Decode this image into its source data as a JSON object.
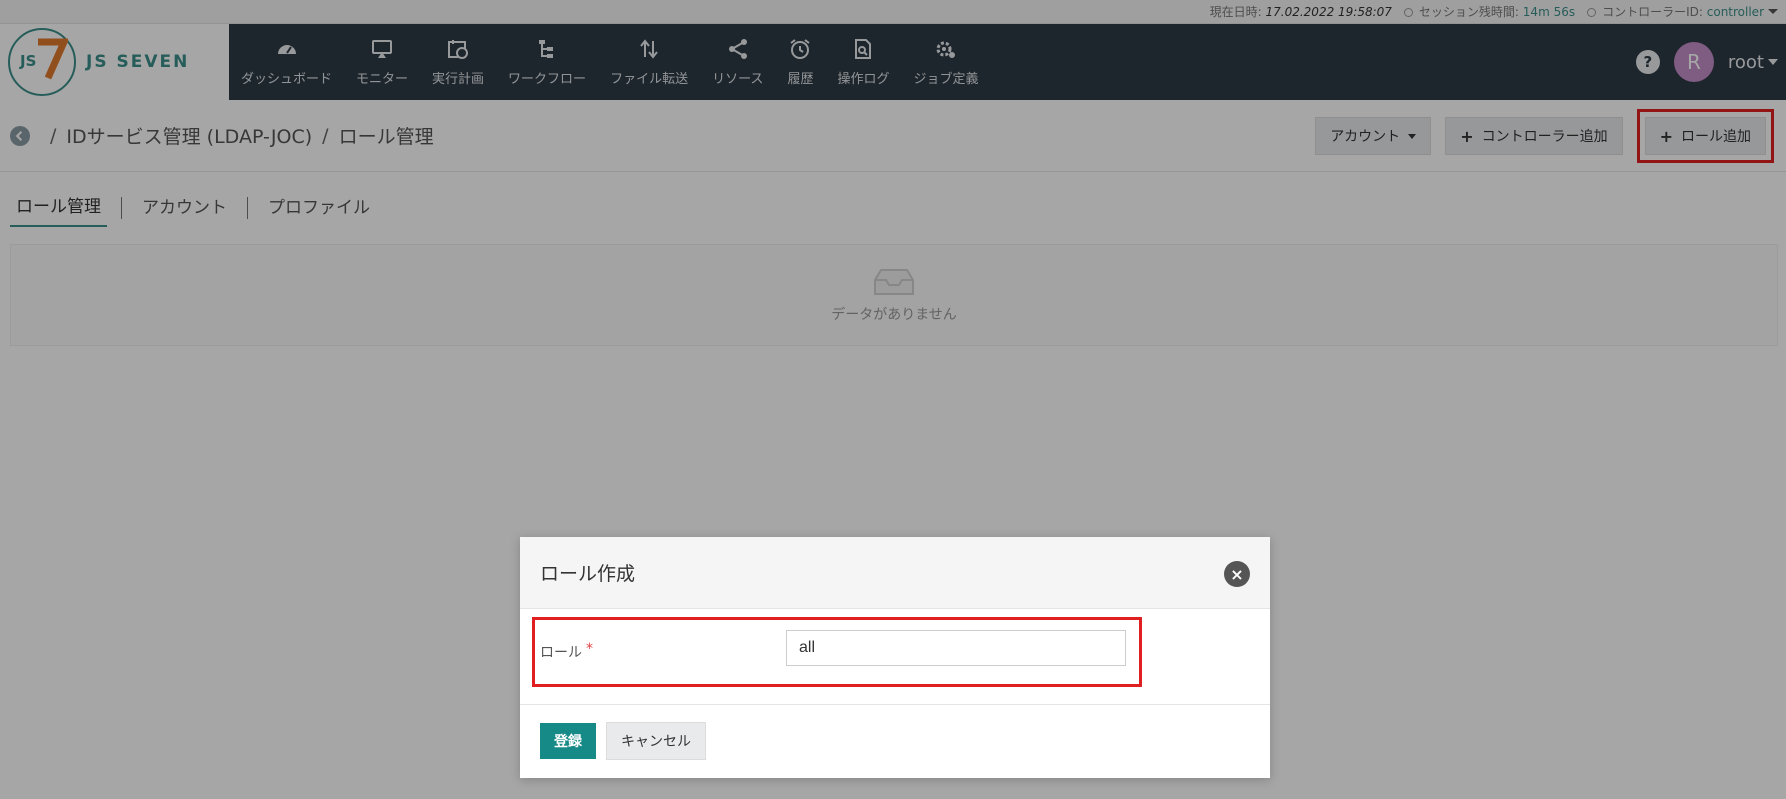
{
  "status": {
    "datetime_label": "現在日時:",
    "datetime_value": "17.02.2022 19:58:07",
    "session_label": "セッション残時間:",
    "session_value": "14m 56s",
    "controller_label": "コントローラーID:",
    "controller_value": "controller"
  },
  "logo": {
    "text": "JS SEVEN",
    "mark": "JS"
  },
  "nav": {
    "items": [
      {
        "label": "ダッシュボード",
        "icon": "dashboard-icon"
      },
      {
        "label": "モニター",
        "icon": "monitor-icon"
      },
      {
        "label": "実行計画",
        "icon": "calendar-clock-icon"
      },
      {
        "label": "ワークフロー",
        "icon": "workflow-icon"
      },
      {
        "label": "ファイル転送",
        "icon": "transfer-icon"
      },
      {
        "label": "リソース",
        "icon": "share-icon"
      },
      {
        "label": "履歴",
        "icon": "alarm-clock-icon"
      },
      {
        "label": "操作ログ",
        "icon": "audit-log-icon"
      },
      {
        "label": "ジョブ定義",
        "icon": "gears-icon"
      }
    ],
    "help": "?",
    "avatar_letter": "R",
    "user": "root"
  },
  "breadcrumb": {
    "items": [
      "IDサービス管理 (LDAP-JOC)",
      "ロール管理"
    ],
    "separator": "/"
  },
  "actions": {
    "account_label": "アカウント",
    "add_controller_label": "コントローラー追加",
    "add_role_label": "ロール追加"
  },
  "tabs": [
    "ロール管理",
    "アカウント",
    "プロファイル"
  ],
  "empty": {
    "message": "データがありません"
  },
  "modal": {
    "title": "ロール作成",
    "field_label": "ロール",
    "required_mark": "*",
    "field_value": "all",
    "submit_label": "登録",
    "cancel_label": "キャンセル"
  },
  "colors": {
    "accent": "#3b8f8a",
    "navbar": "#2e3b46",
    "primary_button": "#168a86",
    "highlight": "#e02020"
  }
}
